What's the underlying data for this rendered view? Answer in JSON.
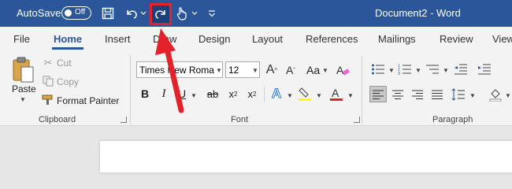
{
  "titlebar": {
    "autosave_label": "AutoSave",
    "autosave_state": "Off",
    "title": "Document2  -  Word"
  },
  "tabs": [
    "File",
    "Home",
    "Insert",
    "Draw",
    "Design",
    "Layout",
    "References",
    "Mailings",
    "Review",
    "View"
  ],
  "active_tab": "Home",
  "clipboard": {
    "paste": "Paste",
    "cut": "Cut",
    "copy": "Copy",
    "format_painter": "Format Painter",
    "label": "Clipboard"
  },
  "font": {
    "name": "Times New Roma",
    "size": "12",
    "case_label": "Aa",
    "label": "Font"
  },
  "paragraph": {
    "label": "Paragraph"
  },
  "colors": {
    "title_bar": "#2b579a",
    "highlight_box": "#e3232b",
    "arrow": "#e3232b"
  }
}
